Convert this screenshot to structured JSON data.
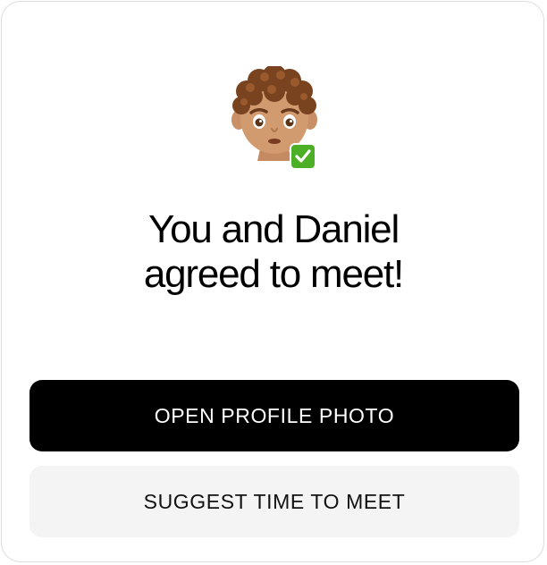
{
  "match_card": {
    "avatar": {
      "icon": "curly-haired-man-emoji-icon",
      "badge_icon": "check-mark-button-icon"
    },
    "headline_line1": "You and Daniel",
    "headline_line2": "agreed to meet!",
    "primary_button_label": "OPEN PROFILE PHOTO",
    "secondary_button_label": "SUGGEST TIME TO MEET",
    "colors": {
      "primary_button_bg": "#000000",
      "primary_button_text": "#ffffff",
      "secondary_button_bg": "#f4f4f4",
      "secondary_button_text": "#111111",
      "badge_green": "#4caf26"
    }
  }
}
